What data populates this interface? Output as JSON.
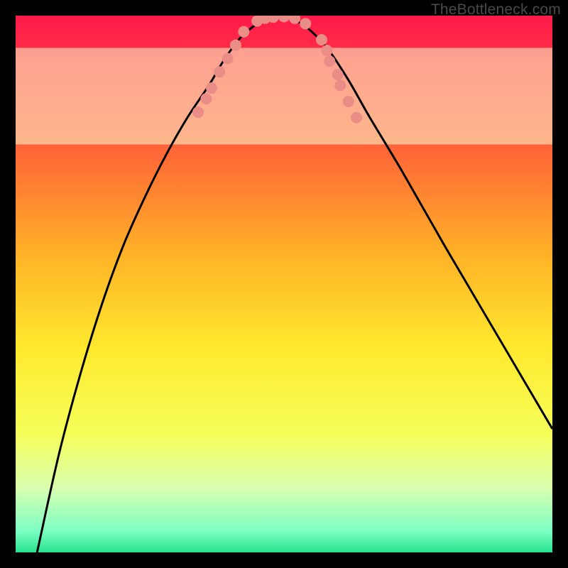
{
  "watermark": "TheBottleneck.com",
  "chart_data": {
    "type": "line",
    "title": "",
    "xlabel": "",
    "ylabel": "",
    "xlim": [
      0,
      100
    ],
    "ylim": [
      0,
      100
    ],
    "gradient_stops": [
      {
        "offset": 0,
        "color": "#ff1a4b"
      },
      {
        "offset": 22,
        "color": "#ff5a3a"
      },
      {
        "offset": 45,
        "color": "#ffb427"
      },
      {
        "offset": 62,
        "color": "#ffe92e"
      },
      {
        "offset": 78,
        "color": "#f6ff5a"
      },
      {
        "offset": 88,
        "color": "#d9ffb0"
      },
      {
        "offset": 96,
        "color": "#7dffc3"
      },
      {
        "offset": 100,
        "color": "#26e28d"
      }
    ],
    "pale_band": {
      "y0": 76,
      "y1": 94,
      "color": "#fdffd0",
      "opacity": 0.55
    },
    "series": [
      {
        "name": "bottleneck-curve",
        "x": [
          4,
          8,
          12,
          16,
          20,
          24,
          28,
          32,
          36,
          39,
          42,
          45,
          47,
          49,
          51,
          54,
          58,
          62,
          66,
          72,
          80,
          90,
          100
        ],
        "y": [
          0,
          18,
          33,
          46,
          57,
          66,
          74,
          81,
          87,
          92,
          96,
          98.5,
          99.5,
          99.8,
          99.5,
          98,
          94,
          88,
          81,
          71,
          57,
          40,
          23
        ]
      }
    ],
    "scatter": {
      "name": "sample-points",
      "color": "#e98d86",
      "radius": 8,
      "points": [
        {
          "x": 34,
          "y": 82
        },
        {
          "x": 35.5,
          "y": 84.5
        },
        {
          "x": 36.5,
          "y": 86.5
        },
        {
          "x": 38,
          "y": 89.5
        },
        {
          "x": 39.5,
          "y": 92
        },
        {
          "x": 41,
          "y": 94.5
        },
        {
          "x": 42.5,
          "y": 97
        },
        {
          "x": 45,
          "y": 99
        },
        {
          "x": 46.5,
          "y": 99.5
        },
        {
          "x": 48,
          "y": 99.7
        },
        {
          "x": 50,
          "y": 99.8
        },
        {
          "x": 52,
          "y": 99.5
        },
        {
          "x": 54,
          "y": 98.5
        },
        {
          "x": 57,
          "y": 95.5
        },
        {
          "x": 58,
          "y": 93.5
        },
        {
          "x": 58.5,
          "y": 91.5
        },
        {
          "x": 60,
          "y": 89
        },
        {
          "x": 60.5,
          "y": 87
        },
        {
          "x": 62,
          "y": 84
        },
        {
          "x": 63.5,
          "y": 81
        }
      ]
    }
  }
}
